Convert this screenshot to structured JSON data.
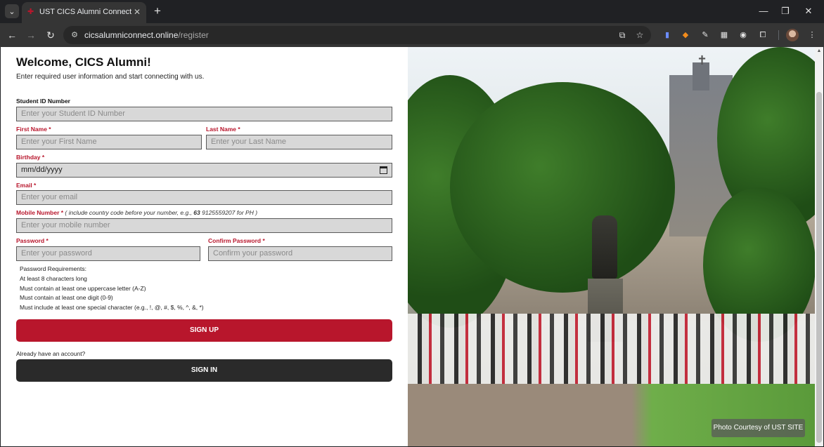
{
  "browser": {
    "tab_title": "UST CICS Alumni Connect",
    "url_host": "cicsalumniconnect.online",
    "url_path": "/register"
  },
  "form": {
    "heading": "Welcome, CICS Alumni!",
    "subheading": "Enter required user information and start connecting with us.",
    "student_id": {
      "label": "Student ID Number",
      "placeholder": "Enter your Student ID Number"
    },
    "first_name": {
      "label": "First Name *",
      "placeholder": "Enter your First Name"
    },
    "last_name": {
      "label": "Last Name *",
      "placeholder": "Enter your Last Name"
    },
    "birthday": {
      "label": "Birthday *",
      "value": "mm/dd/yyyy"
    },
    "email": {
      "label": "Email *",
      "placeholder": "Enter your email"
    },
    "mobile": {
      "label": "Mobile Number *",
      "hint_pre": " ( include country code before your number, e.g., ",
      "hint_bold": "63",
      "hint_post": " 9125559207 for PH )",
      "placeholder": "Enter your mobile number"
    },
    "password": {
      "label": "Password *",
      "placeholder": "Enter your password"
    },
    "confirm_password": {
      "label": "Confirm Password *",
      "placeholder": "Confirm your password"
    },
    "requirements": [
      "Password Requirements:",
      "At least 8 characters long",
      "Must contain at least one uppercase letter (A-Z)",
      "Must contain at least one digit (0-9)",
      "Must include at least one special character (e.g., !, @, #, $, %, ^, &, *)"
    ],
    "signup_label": "SIGN UP",
    "have_account": "Already have an account?",
    "signin_label": "SIGN IN"
  },
  "photo": {
    "credit": "Photo Courtesy of UST SITE"
  },
  "colors": {
    "accent": "#b8162c",
    "dark_button": "#2a2a2a",
    "field_bg": "#d8d8d8"
  }
}
